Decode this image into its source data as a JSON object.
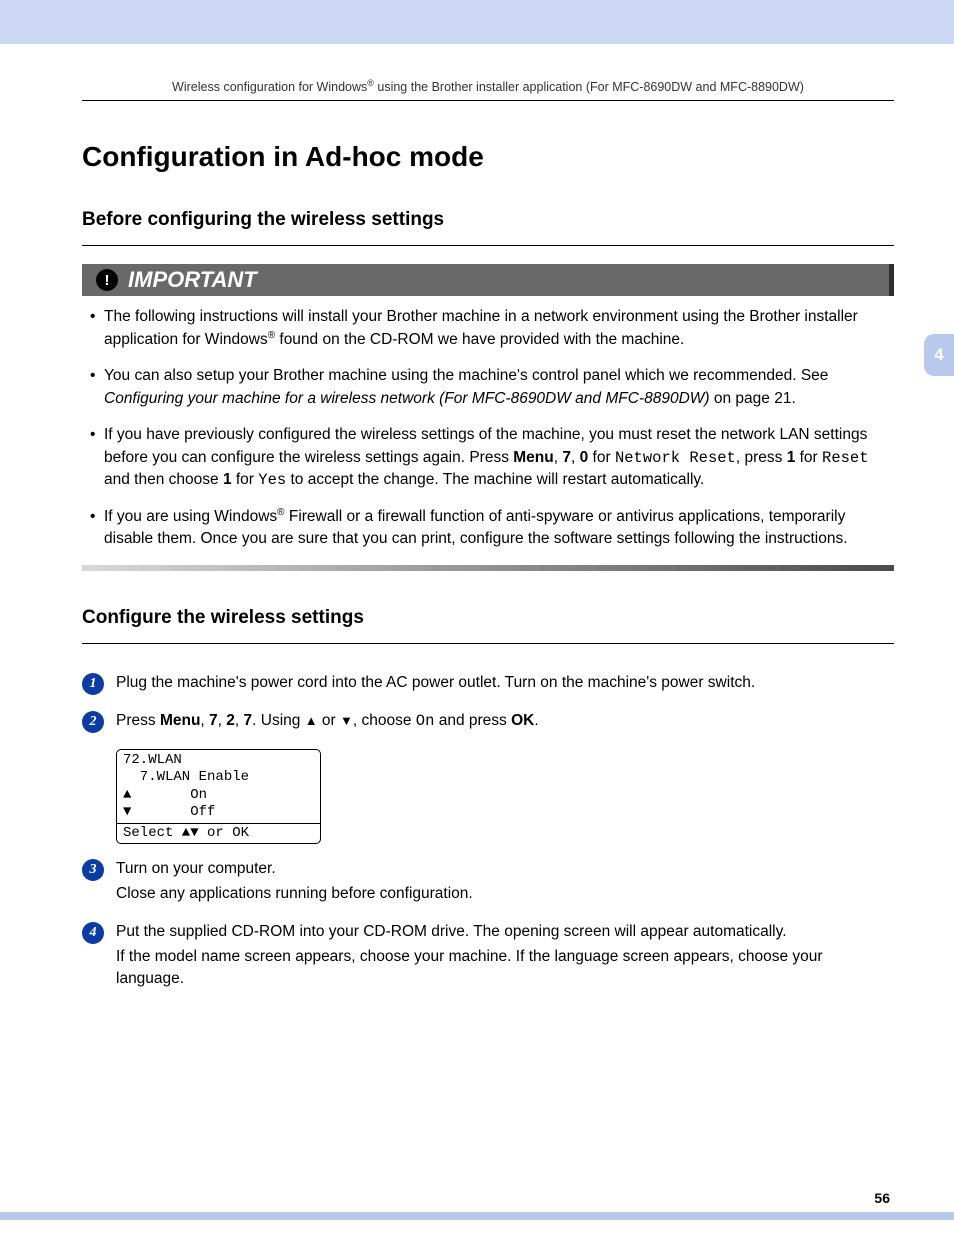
{
  "header": {
    "running_head_pre": "Wireless configuration for Windows",
    "running_head_sup": "®",
    "running_head_post": " using the Brother installer application (For MFC-8690DW and MFC-8890DW)"
  },
  "title": "Configuration in Ad-hoc mode",
  "section1_heading": "Before configuring the wireless settings",
  "important_label": "IMPORTANT",
  "tab_number": "4",
  "page_number": "56",
  "bullets": {
    "b1_a": "The following instructions will install your Brother machine in a network environment using the Brother installer application for Windows",
    "b1_sup": "®",
    "b1_b": " found on the CD-ROM we have provided with the machine.",
    "b2_a": "You can also setup your Brother machine using the machine's control panel which we recommended. See ",
    "b2_ital": "Configuring your machine for a wireless network (For MFC-8690DW and MFC-8890DW)",
    "b2_b": " on page 21.",
    "b3_a": "If you have previously configured the wireless settings of the machine, you must reset the network LAN settings before you can configure the wireless settings again. Press ",
    "b3_menu": "Menu",
    "b3_b": ", ",
    "b3_7": "7",
    "b3_c": ", ",
    "b3_0": "0",
    "b3_d": " for ",
    "b3_nr": "Network Reset",
    "b3_e": ", press ",
    "b3_1a": "1",
    "b3_f": " for ",
    "b3_reset": "Reset",
    "b3_g": " and then choose ",
    "b3_1b": "1",
    "b3_h": " for ",
    "b3_yes": "Yes",
    "b3_i": " to accept the change. The machine will restart automatically.",
    "b4_a": "If you are using Windows",
    "b4_sup": "®",
    "b4_b": " Firewall or a firewall function of anti-spyware or antivirus applications, temporarily disable them. Once you are sure that you can print, configure the software settings following the instructions."
  },
  "section2_heading": "Configure the wireless settings",
  "steps": {
    "s1": "Plug the machine's power cord into the AC power outlet. Turn on the machine's power switch.",
    "s2_a": "Press ",
    "s2_menu": "Menu",
    "s2_b": ", ",
    "s2_7": "7",
    "s2_c": ", ",
    "s2_2": "2",
    "s2_d": ", ",
    "s2_7b": "7",
    "s2_e": ". Using ",
    "s2_up": "▲",
    "s2_f": " or ",
    "s2_down": "▼",
    "s2_g": ", choose ",
    "s2_on": "On",
    "s2_h": " and press ",
    "s2_ok": "OK",
    "s2_i": ".",
    "s3_a": "Turn on your computer.",
    "s3_b": "Close any applications running before configuration.",
    "s4_a": "Put the supplied CD-ROM into your CD-ROM drive. The opening screen will appear automatically.",
    "s4_b": "If the model name screen appears, choose your machine. If the language screen appears, choose your language."
  },
  "lcd": {
    "l1": "72.WLAN",
    "l2": "  7.WLAN Enable",
    "l3": "▲       On",
    "l4": "▼       Off",
    "l5": "Select ▲▼ or OK"
  }
}
